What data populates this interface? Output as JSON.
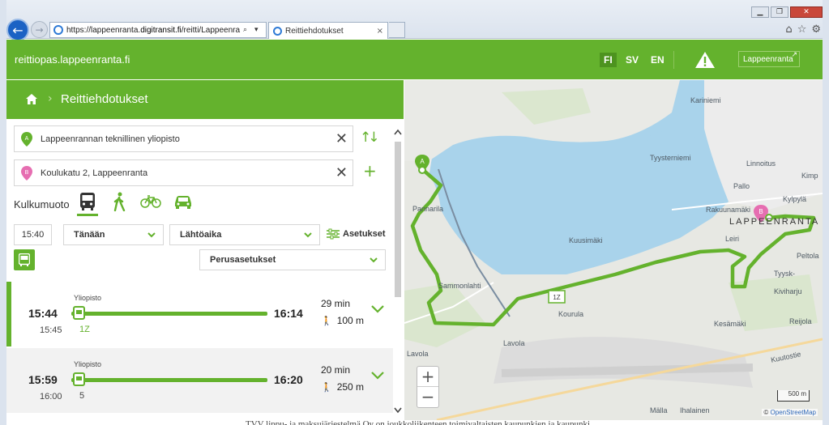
{
  "browser": {
    "url_prefix": "https://lappeenranta.",
    "url_domain": "digitransit.fi",
    "url_path": "/reitti/Lappeenra",
    "url_tools": "⌕ ▾ 🔒 ↻",
    "tab_title": "Reittiehdotukset",
    "tab_close": "×",
    "window_controls": [
      "▁",
      "❐",
      "✕"
    ],
    "toolbar_icons": [
      "⌂",
      "☆",
      "⚙"
    ]
  },
  "header": {
    "site_name": "reittiopas.lappeenranta.fi",
    "languages": [
      "FI",
      "SV",
      "EN"
    ],
    "active_language": "FI",
    "city_button": "Lappeenranta",
    "city_button_arrow": "↗",
    "accent_color": "#64b22d"
  },
  "breadcrumb": {
    "separator": "›",
    "title": "Reittiehdotukset"
  },
  "search": {
    "origin": "Lappeenrannan teknillinen yliopisto",
    "origin_marker": "A",
    "destination": "Koulukatu 2, Lappeenranta",
    "destination_marker": "B",
    "clear_icon": "✕",
    "swap_icon": "↑↓",
    "add_icon": "+"
  },
  "transport": {
    "label": "Kulkumuoto",
    "modes": [
      "bus",
      "walk",
      "bicycle",
      "car"
    ],
    "active_mode": "bus"
  },
  "time_controls": {
    "time": "15:40",
    "day": "Tänään",
    "departure_mode": "Lähtöaika",
    "settings": "Asetukset",
    "preset": "Perusasetukset"
  },
  "itineraries": [
    {
      "stop": "Yliopisto",
      "departure": "15:44",
      "original_time": "15:45",
      "route": "1Z",
      "arrival": "16:14",
      "duration": "29 min",
      "walk": "100 m",
      "walk_icon": "🚶",
      "selected": true
    },
    {
      "stop": "Yliopisto",
      "departure": "15:59",
      "original_time": "16:00",
      "route": "5",
      "arrival": "16:20",
      "duration": "20 min",
      "walk": "250 m",
      "walk_icon": "🚶",
      "selected": false
    }
  ],
  "map": {
    "places": {
      "kariniemi": "Kariniemi",
      "tyysterniemi": "Tyysterniemi",
      "linnoitus": "Linnoitus",
      "kimp": "Kimp",
      "pallo": "Pallo",
      "kylpyla": "Kylpylä",
      "rakuunamaki": "Rakuunamäki",
      "lappeenranta": "LAPPEENRANTA",
      "pannarila": "Pannarila",
      "kuusimaki": "Kuusimäki",
      "leiri": "Leiri",
      "peltola": "Peltola",
      "tyysk": "Tyysk-",
      "kiviharju": "Kiviharju",
      "sammonlahti": "Sammonlahti",
      "kourula": "Kourula",
      "kesamaki": "Kesämäki",
      "reijola": "Reijola",
      "lavola1": "Lavola",
      "lavola2": "Lavola",
      "kuutostie": "Kuutostie",
      "malla": "Mälla",
      "ihalainen": "Ihalainen"
    },
    "route_label": "1Z",
    "zoom_in": "+",
    "zoom_out": "−",
    "scale": "500 m",
    "attribution_prefix": "© ",
    "attribution": "OpenStreetMap",
    "water_color": "#a9d3eb",
    "route_color": "#64b22d"
  },
  "footer_text": "TVV lippu- ja maksujärjestelmä Oy on joukkoliikenteen toimivaltaisten kaupunkien ja kaupunki"
}
